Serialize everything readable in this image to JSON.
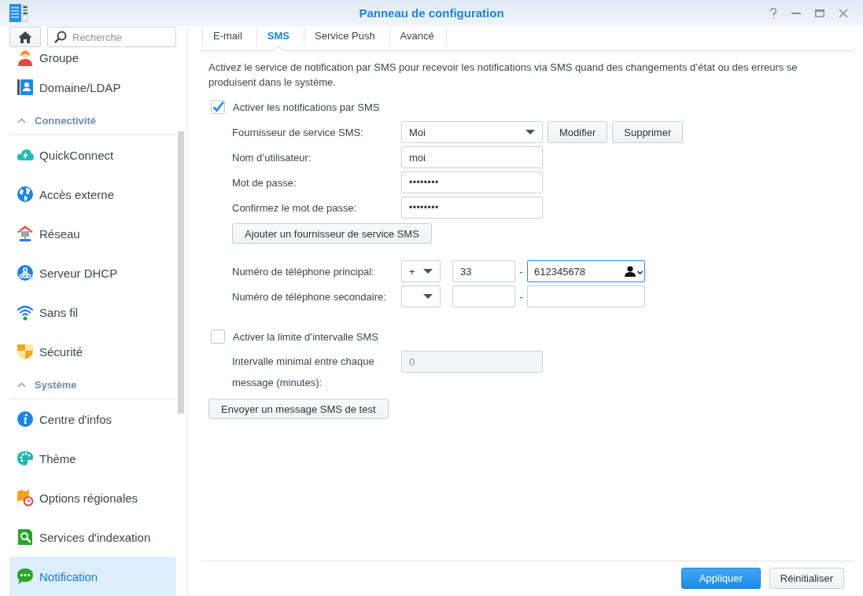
{
  "window": {
    "title": "Panneau de configuration"
  },
  "sidebar": {
    "search": {
      "placeholder": "Recherche"
    },
    "groups": [
      {
        "items": [
          {
            "label": "Groupe",
            "selected": false
          },
          {
            "label": "Domaine/LDAP",
            "selected": false
          }
        ]
      },
      {
        "title": "Connectivité",
        "expanded": true,
        "items": [
          {
            "label": "QuickConnect",
            "selected": false
          },
          {
            "label": "Accès externe",
            "selected": false
          },
          {
            "label": "Réseau",
            "selected": false
          },
          {
            "label": "Serveur DHCP",
            "selected": false
          },
          {
            "label": "Sans fil",
            "selected": false
          },
          {
            "label": "Sécurité",
            "selected": false
          }
        ]
      },
      {
        "title": "Système",
        "expanded": true,
        "items": [
          {
            "label": "Centre d'infos",
            "selected": false
          },
          {
            "label": "Thème",
            "selected": false
          },
          {
            "label": "Options régionales",
            "selected": false
          },
          {
            "label": "Services d'indexation",
            "selected": false
          },
          {
            "label": "Notification",
            "selected": true
          }
        ]
      }
    ]
  },
  "tabs": [
    {
      "label": "E-mail",
      "selected": false
    },
    {
      "label": "SMS",
      "selected": true
    },
    {
      "label": "Service Push",
      "selected": false
    },
    {
      "label": "Avancé",
      "selected": false
    }
  ],
  "sms": {
    "description": "Activez le service de notification par SMS pour recevoir les notifications via SMS quand des changements d’état ou des erreurs se produisent dans le système.",
    "enable": {
      "label": "Activer les notifications par SMS",
      "checked": true
    },
    "fields": [
      {
        "kind": "select",
        "label": "Fournisseur de service SMS:",
        "value": "Moi",
        "buttons": [
          "Modifier",
          "Supprimer"
        ]
      },
      {
        "kind": "text",
        "label": "Nom d’utilisateur:",
        "value": "moi"
      },
      {
        "kind": "password",
        "label": "Mot de passe:",
        "value": "••••••••"
      },
      {
        "kind": "password",
        "label": "Confirmez le mot de passe:",
        "value": "••••••••"
      }
    ],
    "add_provider_button": "Ajouter un fournisseur de service SMS",
    "phones": [
      {
        "label": "Numéro de téléphone principal:",
        "prefix": "+",
        "country_code": "33",
        "separator": "-",
        "number": "612345678",
        "focused": true
      },
      {
        "label": "Numéro de téléphone secondaire:",
        "separator": "-",
        "focused": false
      }
    ],
    "interval": {
      "enable": {
        "label": "Activer la limite d’intervalle SMS",
        "checked": false
      },
      "label": "Intervalle minimal entre chaque message (minutes):",
      "value": "0",
      "disabled": true
    },
    "test_button": "Envoyer un message SMS de test"
  },
  "footer": {
    "buttons": [
      {
        "label": "Appliquer",
        "kind": "primary"
      },
      {
        "label": "Réinitialiser",
        "kind": "secondary"
      }
    ]
  }
}
